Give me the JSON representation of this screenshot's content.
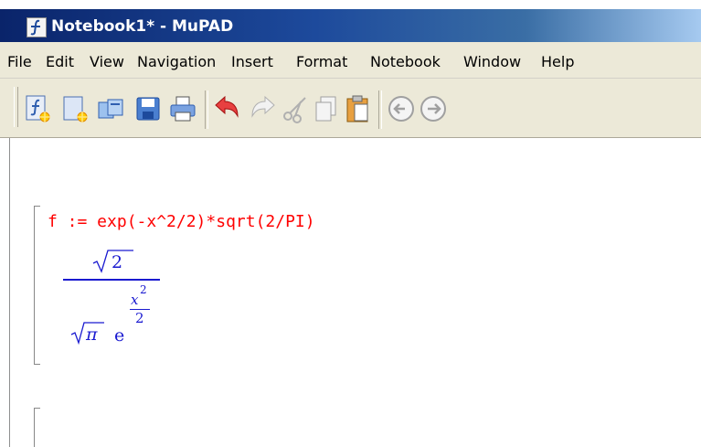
{
  "window": {
    "title": "Notebook1* - MuPAD"
  },
  "menu": {
    "items": [
      "File",
      "Edit",
      "View",
      "Navigation",
      "Insert",
      "Format",
      "Notebook",
      "Window",
      "Help"
    ]
  },
  "toolbar": {
    "buttons": [
      {
        "name": "new-notebook-icon"
      },
      {
        "name": "new-editor-icon"
      },
      {
        "name": "open-icon"
      },
      {
        "name": "save-icon"
      },
      {
        "name": "print-icon"
      },
      {
        "name": "undo-icon"
      },
      {
        "name": "redo-icon"
      },
      {
        "name": "cut-icon"
      },
      {
        "name": "copy-icon"
      },
      {
        "name": "paste-icon"
      },
      {
        "name": "back-icon"
      },
      {
        "name": "forward-icon"
      }
    ]
  },
  "notebook": {
    "input": "f := exp(-x^2/2)*sqrt(2/PI)",
    "output": {
      "numerator_radicand": "2",
      "denominator_radicand": "π",
      "base": "e",
      "exponent_numerator": "x",
      "exponent_power": "2",
      "exponent_denominator": "2"
    }
  },
  "colors": {
    "title_bar": "#0a246a",
    "menu_bg": "#ece9d8",
    "input_text": "#ff0000",
    "output_text": "#1a1ad0"
  }
}
